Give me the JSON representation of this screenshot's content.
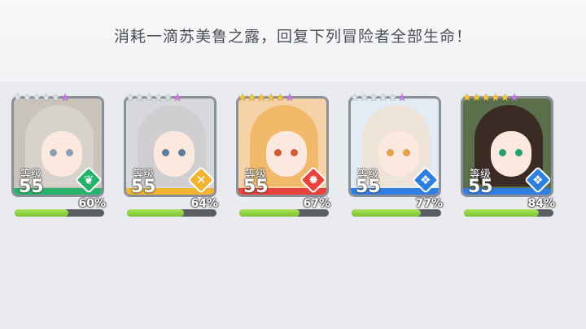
{
  "message": "消耗一滴苏美鲁之露，回复下列冒险者全部生命！",
  "level_label": "等级",
  "adventurers": [
    {
      "level": "55",
      "hp_percent": "60%",
      "hp_fraction": 0.6,
      "stars": 5,
      "element": "wind",
      "element_color": "#27b36a",
      "class_icon": "leaf-icon",
      "accent": "#27b36a"
    },
    {
      "level": "55",
      "hp_percent": "64%",
      "hp_fraction": 0.64,
      "stars": 5,
      "element": "light",
      "element_color": "#f0b430",
      "class_icon": "cross-swords-icon",
      "accent": "#f0b430"
    },
    {
      "level": "55",
      "hp_percent": "67%",
      "hp_fraction": 0.67,
      "stars": 5,
      "element": "fire",
      "element_color": "#e8423a",
      "class_icon": "flame-ring-icon",
      "accent": "#e8423a"
    },
    {
      "level": "55",
      "hp_percent": "77%",
      "hp_fraction": 0.77,
      "stars": 5,
      "element": "water",
      "element_color": "#2f7fe0",
      "class_icon": "shield-icon",
      "accent": "#2f7fe0"
    },
    {
      "level": "55",
      "hp_percent": "84%",
      "hp_fraction": 0.84,
      "stars": 5,
      "element": "water",
      "element_color": "#2f7fe0",
      "class_icon": "shield-icon",
      "accent": "#2f7fe0"
    }
  ]
}
